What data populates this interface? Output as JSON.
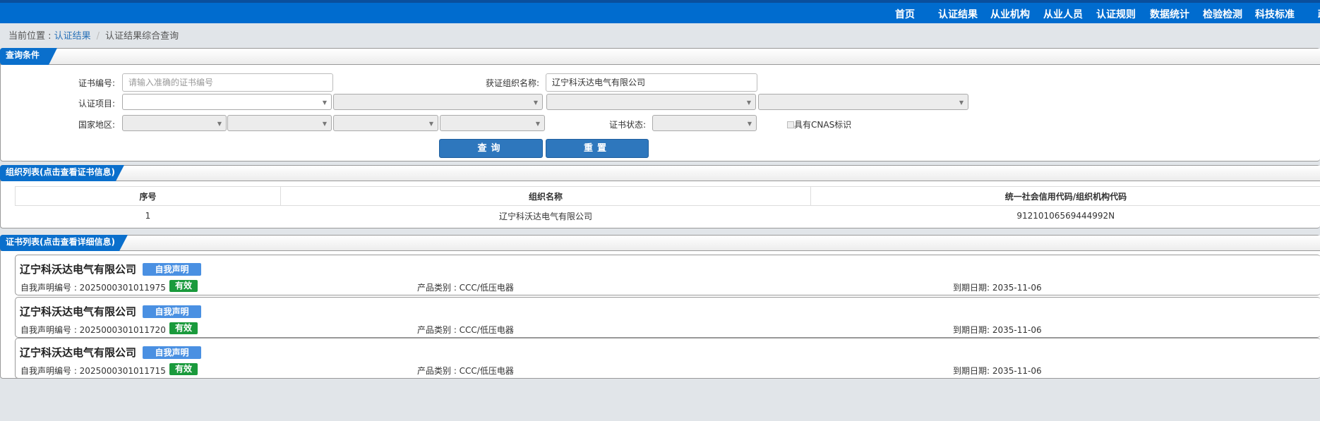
{
  "nav": {
    "items": [
      "首页",
      "认证结果",
      "从业机构",
      "从业人员",
      "认证规则",
      "数据统计",
      "检验检测",
      "科技标准",
      "政"
    ]
  },
  "breadcrumb": {
    "prefix": "当前位置 : ",
    "link": "认证结果",
    "sep": "/",
    "current": "认证结果综合查询"
  },
  "query": {
    "title": "查询条件",
    "cert_no_label": "证书编号:",
    "cert_no_placeholder": "请输入准确的证书编号",
    "cert_no_value": "",
    "org_label": "获证组织名称:",
    "org_value": "辽宁科沃达电气有限公司",
    "project_label": "认证项目:",
    "region_label": "国家地区:",
    "status_label": "证书状态:",
    "cnas_label": "具有CNAS标识",
    "cnas_checked": false,
    "search_btn": "查询",
    "reset_btn": "重置"
  },
  "orgs": {
    "title": "组织列表(点击查看证书信息)",
    "headers": [
      "序号",
      "组织名称",
      "统一社会信用代码/组织机构代码"
    ],
    "rows": [
      {
        "no": "1",
        "name": "辽宁科沃达电气有限公司",
        "code": "91210106569444992N"
      }
    ]
  },
  "certs": {
    "title": "证书列表(点击查看详细信息)",
    "items": [
      {
        "org": "辽宁科沃达电气有限公司",
        "type_badge": "自我声明",
        "no": "自我声明编号 : 2025000301011975",
        "status": "有效",
        "category": "产品类别 : CCC/低压电器",
        "expiry": "到期日期: 2035-11-06"
      },
      {
        "org": "辽宁科沃达电气有限公司",
        "type_badge": "自我声明",
        "no": "自我声明编号 : 2025000301011720",
        "status": "有效",
        "category": "产品类别 : CCC/低压电器",
        "expiry": "到期日期: 2035-11-06"
      },
      {
        "org": "辽宁科沃达电气有限公司",
        "type_badge": "自我声明",
        "no": "自我声明编号 : 2025000301011715",
        "status": "有效",
        "category": "产品类别 : CCC/低压电器",
        "expiry": "到期日期: 2035-11-06"
      }
    ]
  },
  "colors": {
    "nav": "#006ccf",
    "accent": "#0a6fcc",
    "valid": "#1a9a3c",
    "badge": "#4a90e2"
  }
}
